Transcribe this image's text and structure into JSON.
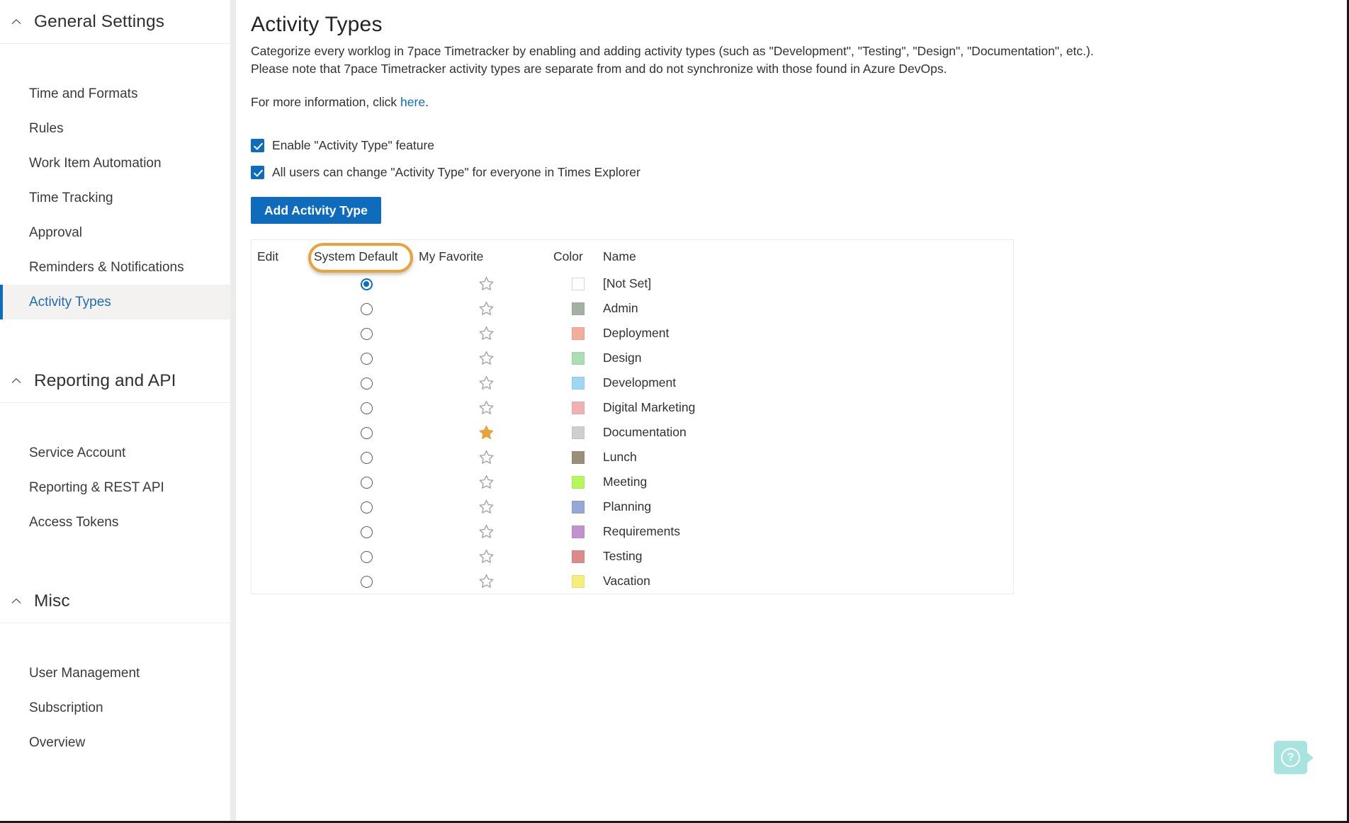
{
  "sidebar": {
    "groups": [
      {
        "title": "General Settings",
        "icon": "chevron-up-icon",
        "items": [
          {
            "label": "Time and Formats",
            "active": false
          },
          {
            "label": "Rules",
            "active": false
          },
          {
            "label": "Work Item Automation",
            "active": false
          },
          {
            "label": "Time Tracking",
            "active": false
          },
          {
            "label": "Approval",
            "active": false
          },
          {
            "label": "Reminders & Notifications",
            "active": false
          },
          {
            "label": "Activity Types",
            "active": true
          }
        ]
      },
      {
        "title": "Reporting and API",
        "icon": "chevron-up-icon",
        "items": [
          {
            "label": "Service Account",
            "active": false
          },
          {
            "label": "Reporting & REST API",
            "active": false
          },
          {
            "label": "Access Tokens",
            "active": false
          }
        ]
      },
      {
        "title": "Misc",
        "icon": "chevron-up-icon",
        "items": [
          {
            "label": "User Management",
            "active": false
          },
          {
            "label": "Subscription",
            "active": false
          },
          {
            "label": "Overview",
            "active": false
          }
        ]
      }
    ]
  },
  "main": {
    "page_title": "Activity Types",
    "description_line1": "Categorize every worklog in 7pace Timetracker by enabling and adding activity types (such as \"Development\", \"Testing\", \"Design\", \"Documentation\", etc.).",
    "description_line2": "Please note that 7pace Timetracker activity types are separate from and do not synchronize with those found in Azure DevOps.",
    "more_info_prefix": "For more information, click ",
    "more_info_link": "here",
    "more_info_suffix": ".",
    "checkbox_enable_feature": "Enable \"Activity Type\" feature",
    "checkbox_all_users": "All users can change \"Activity Type\" for everyone in Times Explorer",
    "add_button_label": "Add Activity Type",
    "annotation": {
      "target": "System Default",
      "color": "#e8a33d"
    },
    "table": {
      "columns": [
        "Edit",
        "System Default",
        "My Favorite",
        "Color",
        "Name"
      ],
      "rows": [
        {
          "system_default": true,
          "favorite": false,
          "color": "",
          "name": "[Not Set]"
        },
        {
          "system_default": false,
          "favorite": false,
          "color": "#a5b0a5",
          "name": "Admin"
        },
        {
          "system_default": false,
          "favorite": false,
          "color": "#f4ad9b",
          "name": "Deployment"
        },
        {
          "system_default": false,
          "favorite": false,
          "color": "#a9dfb1",
          "name": "Design"
        },
        {
          "system_default": false,
          "favorite": false,
          "color": "#9fd6f5",
          "name": "Development"
        },
        {
          "system_default": false,
          "favorite": false,
          "color": "#efb1b1",
          "name": "Digital Marketing"
        },
        {
          "system_default": false,
          "favorite": true,
          "color": "#cfcfcf",
          "name": "Documentation"
        },
        {
          "system_default": false,
          "favorite": false,
          "color": "#9b8f79",
          "name": "Lunch"
        },
        {
          "system_default": false,
          "favorite": false,
          "color": "#b4f85c",
          "name": "Meeting"
        },
        {
          "system_default": false,
          "favorite": false,
          "color": "#97a7d6",
          "name": "Planning"
        },
        {
          "system_default": false,
          "favorite": false,
          "color": "#c093cf",
          "name": "Requirements"
        },
        {
          "system_default": false,
          "favorite": false,
          "color": "#dd8a8a",
          "name": "Testing"
        },
        {
          "system_default": false,
          "favorite": false,
          "color": "#f5ee7a",
          "name": "Vacation"
        }
      ]
    }
  },
  "help_widget": {
    "icon": "question-mark-icon",
    "glyph": "?",
    "color": "#a8e3e0"
  },
  "theme": {
    "accent": "#0f6cbd",
    "annotation": "#e8a33d",
    "star_filled": "#e8a33d",
    "star_outline": "#a6a6a6"
  }
}
